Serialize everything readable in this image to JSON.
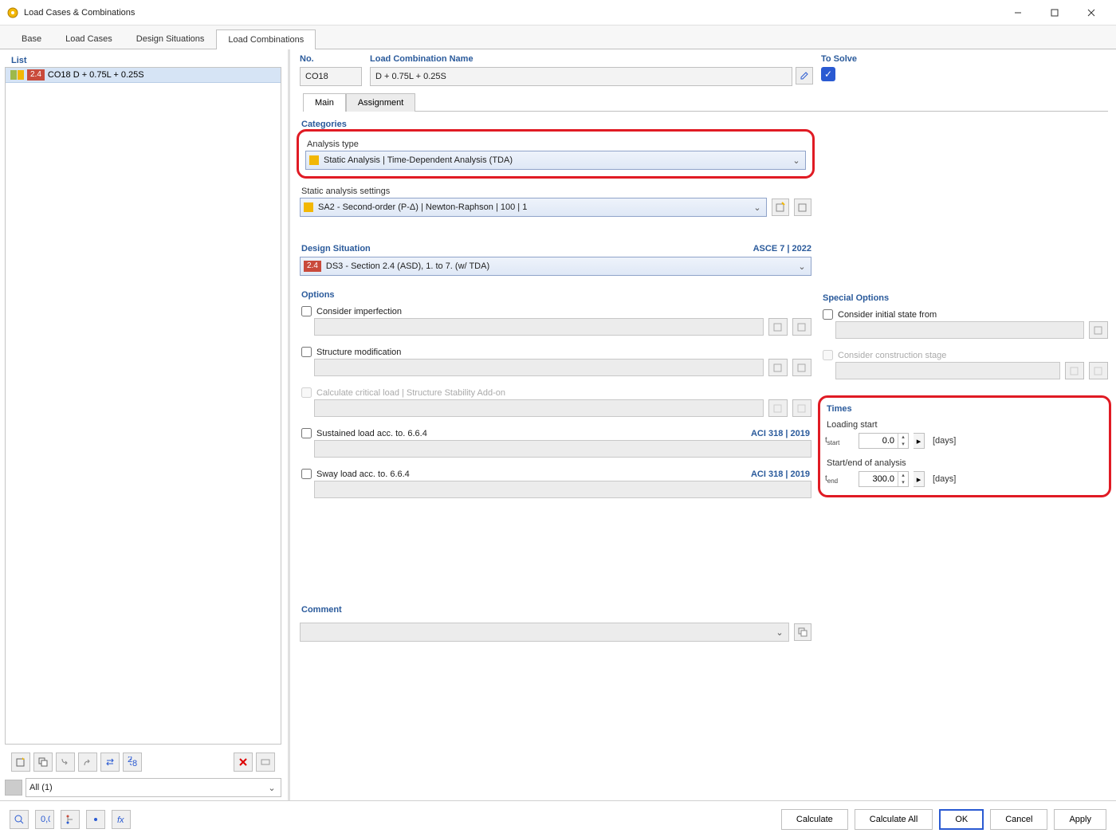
{
  "window": {
    "title": "Load Cases & Combinations"
  },
  "mainTabs": [
    "Base",
    "Load Cases",
    "Design Situations",
    "Load Combinations"
  ],
  "mainTabActive": 3,
  "list": {
    "header": "List",
    "rows": [
      {
        "badge": "2.4",
        "label": "CO18  D + 0.75L + 0.25S"
      }
    ],
    "filter": "All (1)"
  },
  "top": {
    "noLabel": "No.",
    "noValue": "CO18",
    "nameLabel": "Load Combination Name",
    "nameValue": "D + 0.75L + 0.25S",
    "solveLabel": "To Solve"
  },
  "subTabs": [
    "Main",
    "Assignment"
  ],
  "subTabActive": 0,
  "categories": {
    "header": "Categories",
    "analysisTypeLabel": "Analysis type",
    "analysisTypeValue": "Static Analysis | Time-Dependent Analysis (TDA)",
    "staticSettingsLabel": "Static analysis settings",
    "staticSettingsValue": "SA2 - Second-order (P-Δ) | Newton-Raphson | 100 | 1"
  },
  "designSituation": {
    "header": "Design Situation",
    "standard": "ASCE 7 | 2022",
    "badge": "2.4",
    "value": "DS3 - Section 2.4 (ASD), 1. to 7. (w/ TDA)"
  },
  "options": {
    "header": "Options",
    "imperfection": "Consider imperfection",
    "structMod": "Structure modification",
    "critical": "Calculate critical load | Structure Stability Add-on",
    "sustained": "Sustained load acc. to. 6.6.4",
    "sway": "Sway load acc. to. 6.6.4",
    "aciTag": "ACI 318 | 2019"
  },
  "specialOptions": {
    "header": "Special Options",
    "initialState": "Consider initial state from",
    "constructionStage": "Consider construction stage"
  },
  "times": {
    "header": "Times",
    "loadingStartLabel": "Loading start",
    "loadingStartVar": "t_start",
    "loadingStartValue": "0.0",
    "startEndLabel": "Start/end of analysis",
    "startEndVar": "t_end",
    "startEndValue": "300.0",
    "unit": "[days]"
  },
  "comment": {
    "header": "Comment"
  },
  "buttons": {
    "calculate": "Calculate",
    "calculateAll": "Calculate All",
    "ok": "OK",
    "cancel": "Cancel",
    "apply": "Apply"
  }
}
